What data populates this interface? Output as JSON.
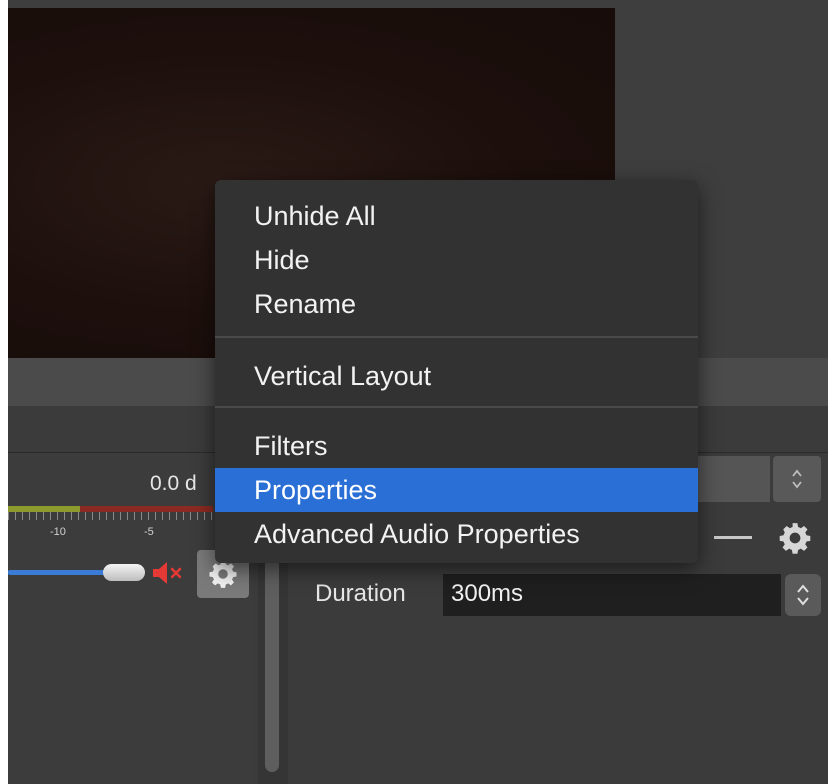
{
  "context_menu": {
    "items": [
      {
        "label": "Unhide All"
      },
      {
        "label": "Hide"
      },
      {
        "label": "Rename"
      },
      {
        "label": "Vertical Layout"
      },
      {
        "label": "Filters"
      },
      {
        "label": "Properties",
        "selected": true
      },
      {
        "label": "Advanced Audio Properties"
      }
    ]
  },
  "mixer": {
    "db_readout": "0.0 d",
    "scale_labels": [
      "-10",
      "-5"
    ],
    "icons": [
      "mute-icon",
      "gear-icon"
    ],
    "mute_color": "#e53935"
  },
  "transition": {
    "duration_label": "Duration",
    "duration_value": "300ms",
    "icons": [
      "remove-icon",
      "gear-icon",
      "spinner-icon"
    ]
  },
  "colors": {
    "menu_highlight": "#2a6fd6",
    "volume_track": "#3a7bd5",
    "meter_green": "#8d9a2d",
    "meter_red": "#8b2a22"
  }
}
